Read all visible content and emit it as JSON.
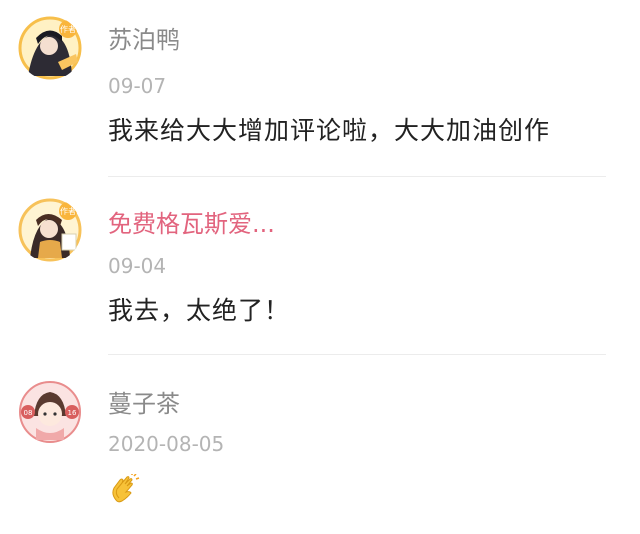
{
  "comments": [
    {
      "author": "苏泊鸭",
      "date": "09-07",
      "text": "我来给大大增加评论啦，大大加油创作",
      "author_badge": "作者",
      "author_color": "#8a8a8a"
    },
    {
      "author": "免费格瓦斯爱...",
      "date": "09-04",
      "text": "我去，太绝了！",
      "author_badge": "作者",
      "author_color": "#e2647e"
    },
    {
      "author": "蔓子茶",
      "date": "2020-08-05",
      "text": "",
      "emoji_icon": "clapping-hands-icon",
      "avatar_badges": [
        "08",
        "16"
      ]
    }
  ]
}
